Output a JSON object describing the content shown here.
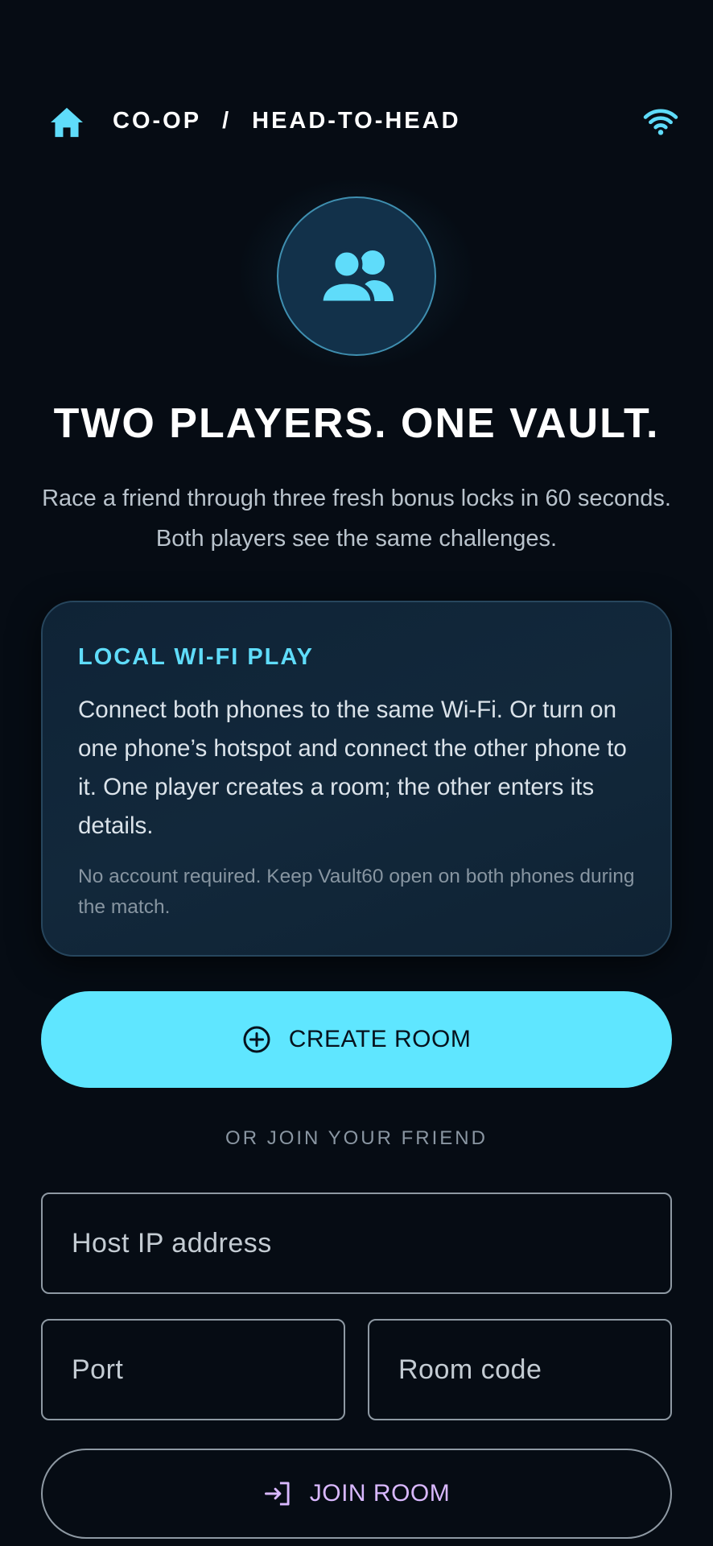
{
  "header": {
    "home_icon": "home-icon",
    "breadcrumb": [
      "CO-OP",
      "/",
      "HEAD-TO-HEAD"
    ],
    "status_icon": "wifi-icon"
  },
  "hero": {
    "icon": "two-players-icon",
    "headline": "TWO PLAYERS. ONE VAULT.",
    "subtext": "Race a friend through three fresh bonus locks in 60 seconds. Both players see the same challenges."
  },
  "card": {
    "title": "LOCAL WI-FI PLAY",
    "body": "Connect both phones to the same Wi-Fi. Or turn on one phone’s hotspot and connect the other phone to it. One player creates a room; the other enters its details.",
    "note": "No account required. Keep Vault60 open on both phones during the match."
  },
  "create_button": {
    "label": "CREATE ROOM",
    "icon": "add-circle-icon"
  },
  "divider_text": "OR JOIN YOUR FRIEND",
  "fields": {
    "host_ip": {
      "placeholder": "Host IP address",
      "value": ""
    },
    "port": {
      "placeholder": "Port",
      "value": ""
    },
    "room_code": {
      "placeholder": "Room code",
      "value": ""
    }
  },
  "join_button": {
    "label": "JOIN ROOM",
    "icon": "login-icon"
  },
  "colors": {
    "background": "#060c14",
    "accent_cyan": "#5fe6ff",
    "card_title": "#5fdcfa",
    "join_label": "#d9b8ff"
  }
}
